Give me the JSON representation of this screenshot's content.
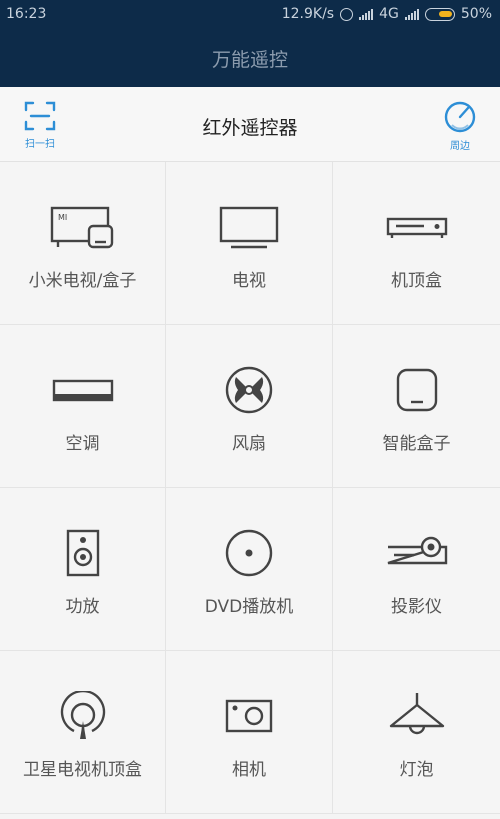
{
  "status_bar": {
    "time": "16:23",
    "net_speed": "12.9K/s",
    "network": "4G",
    "battery": "50%",
    "battery_color": "#f1b21e"
  },
  "app_title": "万能遥控",
  "header": {
    "title": "红外遥控器",
    "scan_label": "扫一扫",
    "scan_icon": "scan-frame-icon",
    "nearby_label": "周边",
    "nearby_icon": "radar-gauge-icon",
    "accent_color": "#2d8ed6"
  },
  "devices": [
    {
      "label": "小米电视/盒子",
      "icon": "mi-tv-box-icon"
    },
    {
      "label": "电视",
      "icon": "tv-icon"
    },
    {
      "label": "机顶盒",
      "icon": "set-top-box-icon"
    },
    {
      "label": "空调",
      "icon": "air-conditioner-icon"
    },
    {
      "label": "风扇",
      "icon": "fan-icon"
    },
    {
      "label": "智能盒子",
      "icon": "smart-box-icon"
    },
    {
      "label": "功放",
      "icon": "amplifier-speaker-icon"
    },
    {
      "label": "DVD播放机",
      "icon": "dvd-disc-icon"
    },
    {
      "label": "投影仪",
      "icon": "projector-icon"
    },
    {
      "label": "卫星电视机顶盒",
      "icon": "satellite-icon"
    },
    {
      "label": "相机",
      "icon": "camera-icon"
    },
    {
      "label": "灯泡",
      "icon": "lamp-icon"
    }
  ]
}
